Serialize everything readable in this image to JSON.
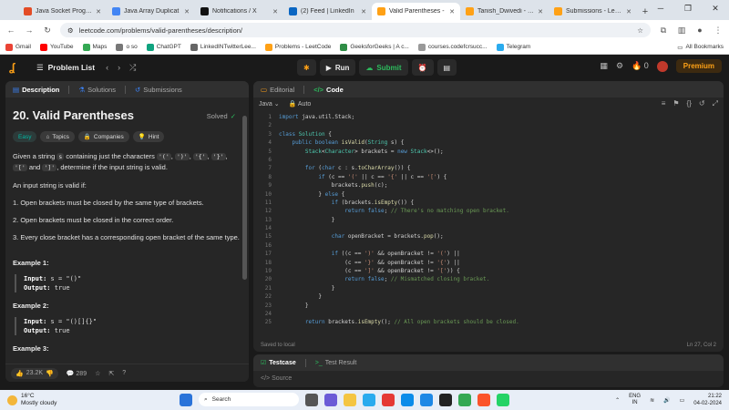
{
  "browser": {
    "tabs": [
      {
        "title": "Java Socket Program",
        "favicon_color": "#e34c26",
        "active": false
      },
      {
        "title": "Java Array Duplicat",
        "favicon_color": "#4285f4",
        "active": false
      },
      {
        "title": "Notifications / X",
        "favicon_color": "#111111",
        "active": false
      },
      {
        "title": "(2) Feed | LinkedIn",
        "favicon_color": "#0a66c2",
        "active": false
      },
      {
        "title": "Valid Parentheses - ",
        "favicon_color": "#ffa116",
        "active": true
      },
      {
        "title": "Tanish_Dwivedi - Lee",
        "favicon_color": "#ffa116",
        "active": false
      },
      {
        "title": "Submissions - LeetC",
        "favicon_color": "#ffa116",
        "active": false
      }
    ],
    "url": "leetcode.com/problems/valid-parentheses/description/",
    "bookmarks": [
      {
        "label": "Gmail",
        "color": "#ea4335"
      },
      {
        "label": "YouTube",
        "color": "#ff0000"
      },
      {
        "label": "Maps",
        "color": "#34a853"
      },
      {
        "label": "o so",
        "color": "#777777"
      },
      {
        "label": "ChatGPT",
        "color": "#10a37f"
      },
      {
        "label": "LinkedINTwitterLee...",
        "color": "#666666"
      },
      {
        "label": "Problems - LeetCode",
        "color": "#ffa116"
      },
      {
        "label": "GeeksforGeeks | A c...",
        "color": "#2f8d46"
      },
      {
        "label": "courses.codefcrsucc...",
        "color": "#999999"
      },
      {
        "label": "Telegram",
        "color": "#2aabee"
      }
    ],
    "all_bookmarks": "All Bookmarks"
  },
  "leetcode": {
    "problem_list": "Problem List",
    "run": "Run",
    "submit": "Submit",
    "streak": "0",
    "premium": "Premium"
  },
  "left": {
    "tabs": [
      "Description",
      "Solutions",
      "Submissions"
    ],
    "title": "20. Valid Parentheses",
    "solved": "Solved",
    "chips": [
      "Easy",
      "Topics",
      "Companies",
      "Hint"
    ],
    "intro_a": "Given a string ",
    "intro_s": "s",
    "intro_b": " containing just the characters ",
    "chars": [
      "'('",
      "')'",
      "'{'",
      "'}'",
      "'['",
      "']'"
    ],
    "intro_c": ", determine if the input string is valid.",
    "and": "and",
    "valid_if": "An input string is valid if:",
    "rules": [
      "1. Open brackets must be closed by the same type of brackets.",
      "2. Open brackets must be closed in the correct order.",
      "3. Every close bracket has a corresponding open bracket of the same type."
    ],
    "examples": [
      {
        "title": "Example 1:",
        "input": "s = \"()\"",
        "output": "true"
      },
      {
        "title": "Example 2:",
        "input": "s = \"()[]{}\"",
        "output": "true"
      },
      {
        "title": "Example 3:"
      }
    ],
    "input_label": "Input:",
    "output_label": "Output:",
    "likes": "23.2K",
    "comments": "289"
  },
  "editor": {
    "tabs": [
      "Editorial",
      "Code"
    ],
    "language": "Java",
    "mode": "Auto",
    "saved": "Saved to local",
    "cursor": "Ln 27, Col 2"
  },
  "testcase": {
    "tabs": [
      "Testcase",
      "Test Result"
    ],
    "source": "Source"
  },
  "taskbar": {
    "temp": "16°C",
    "weather": "Mostly cloudy",
    "search": "Search",
    "lang": "ENG",
    "region": "IN",
    "time": "21:22",
    "date": "04-02-2024"
  }
}
